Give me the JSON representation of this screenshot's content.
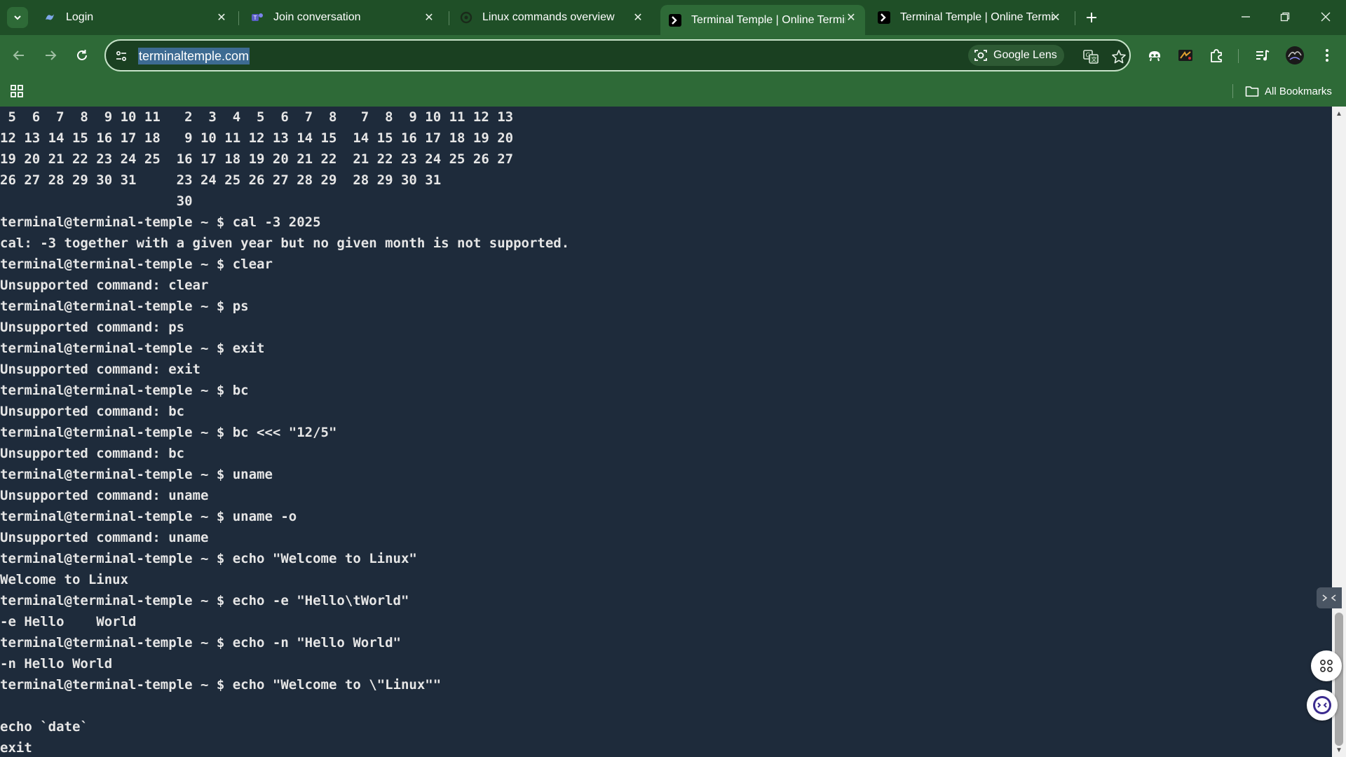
{
  "browser": {
    "tabs": [
      {
        "title": "Login",
        "icon": "copilot-icon",
        "active": false
      },
      {
        "title": "Join conversation",
        "icon": "teams-icon",
        "active": false
      },
      {
        "title": "Linux commands overview",
        "icon": "chatgpt-icon",
        "active": false
      },
      {
        "title": "Terminal Temple | Online Termir",
        "icon": "terminal-icon",
        "active": true
      },
      {
        "title": "Terminal Temple | Online Termir",
        "icon": "terminal-icon",
        "active": false
      }
    ],
    "address_bar": {
      "url": "terminaltemple.com",
      "lens_label": "Google Lens"
    },
    "bookmarks_bar": {
      "all_bookmarks_label": "All Bookmarks"
    },
    "colors": {
      "frame": "#1f4f27",
      "toolbar": "#2e6a37",
      "terminal_background": "#1e2b3b",
      "terminal_text": "#e6e6e6"
    }
  },
  "terminal": {
    "lines": [
      " 5  6  7  8  9 10 11   2  3  4  5  6  7  8   7  8  9 10 11 12 13",
      "12 13 14 15 16 17 18   9 10 11 12 13 14 15  14 15 16 17 18 19 20",
      "19 20 21 22 23 24 25  16 17 18 19 20 21 22  21 22 23 24 25 26 27",
      "26 27 28 29 30 31     23 24 25 26 27 28 29  28 29 30 31",
      "                      30",
      "terminal@terminal-temple ~ $ cal -3 2025",
      "cal: -3 together with a given year but no given month is not supported.",
      "terminal@terminal-temple ~ $ clear",
      "Unsupported command: clear",
      "terminal@terminal-temple ~ $ ps",
      "Unsupported command: ps",
      "terminal@terminal-temple ~ $ exit",
      "Unsupported command: exit",
      "terminal@terminal-temple ~ $ bc",
      "Unsupported command: bc",
      "terminal@terminal-temple ~ $ bc <<< \"12/5\"",
      "Unsupported command: bc",
      "terminal@terminal-temple ~ $ uname",
      "Unsupported command: uname",
      "terminal@terminal-temple ~ $ uname -o",
      "Unsupported command: uname",
      "terminal@terminal-temple ~ $ echo \"Welcome to Linux\"",
      "Welcome to Linux",
      "terminal@terminal-temple ~ $ echo -e \"Hello\\tWorld\"",
      "-e Hello    World",
      "terminal@terminal-temple ~ $ echo -n \"Hello World\"",
      "-n Hello World",
      "terminal@terminal-temple ~ $ echo \"Welcome to \\\"Linux\"\"",
      "",
      "echo `date`",
      "exit"
    ]
  }
}
